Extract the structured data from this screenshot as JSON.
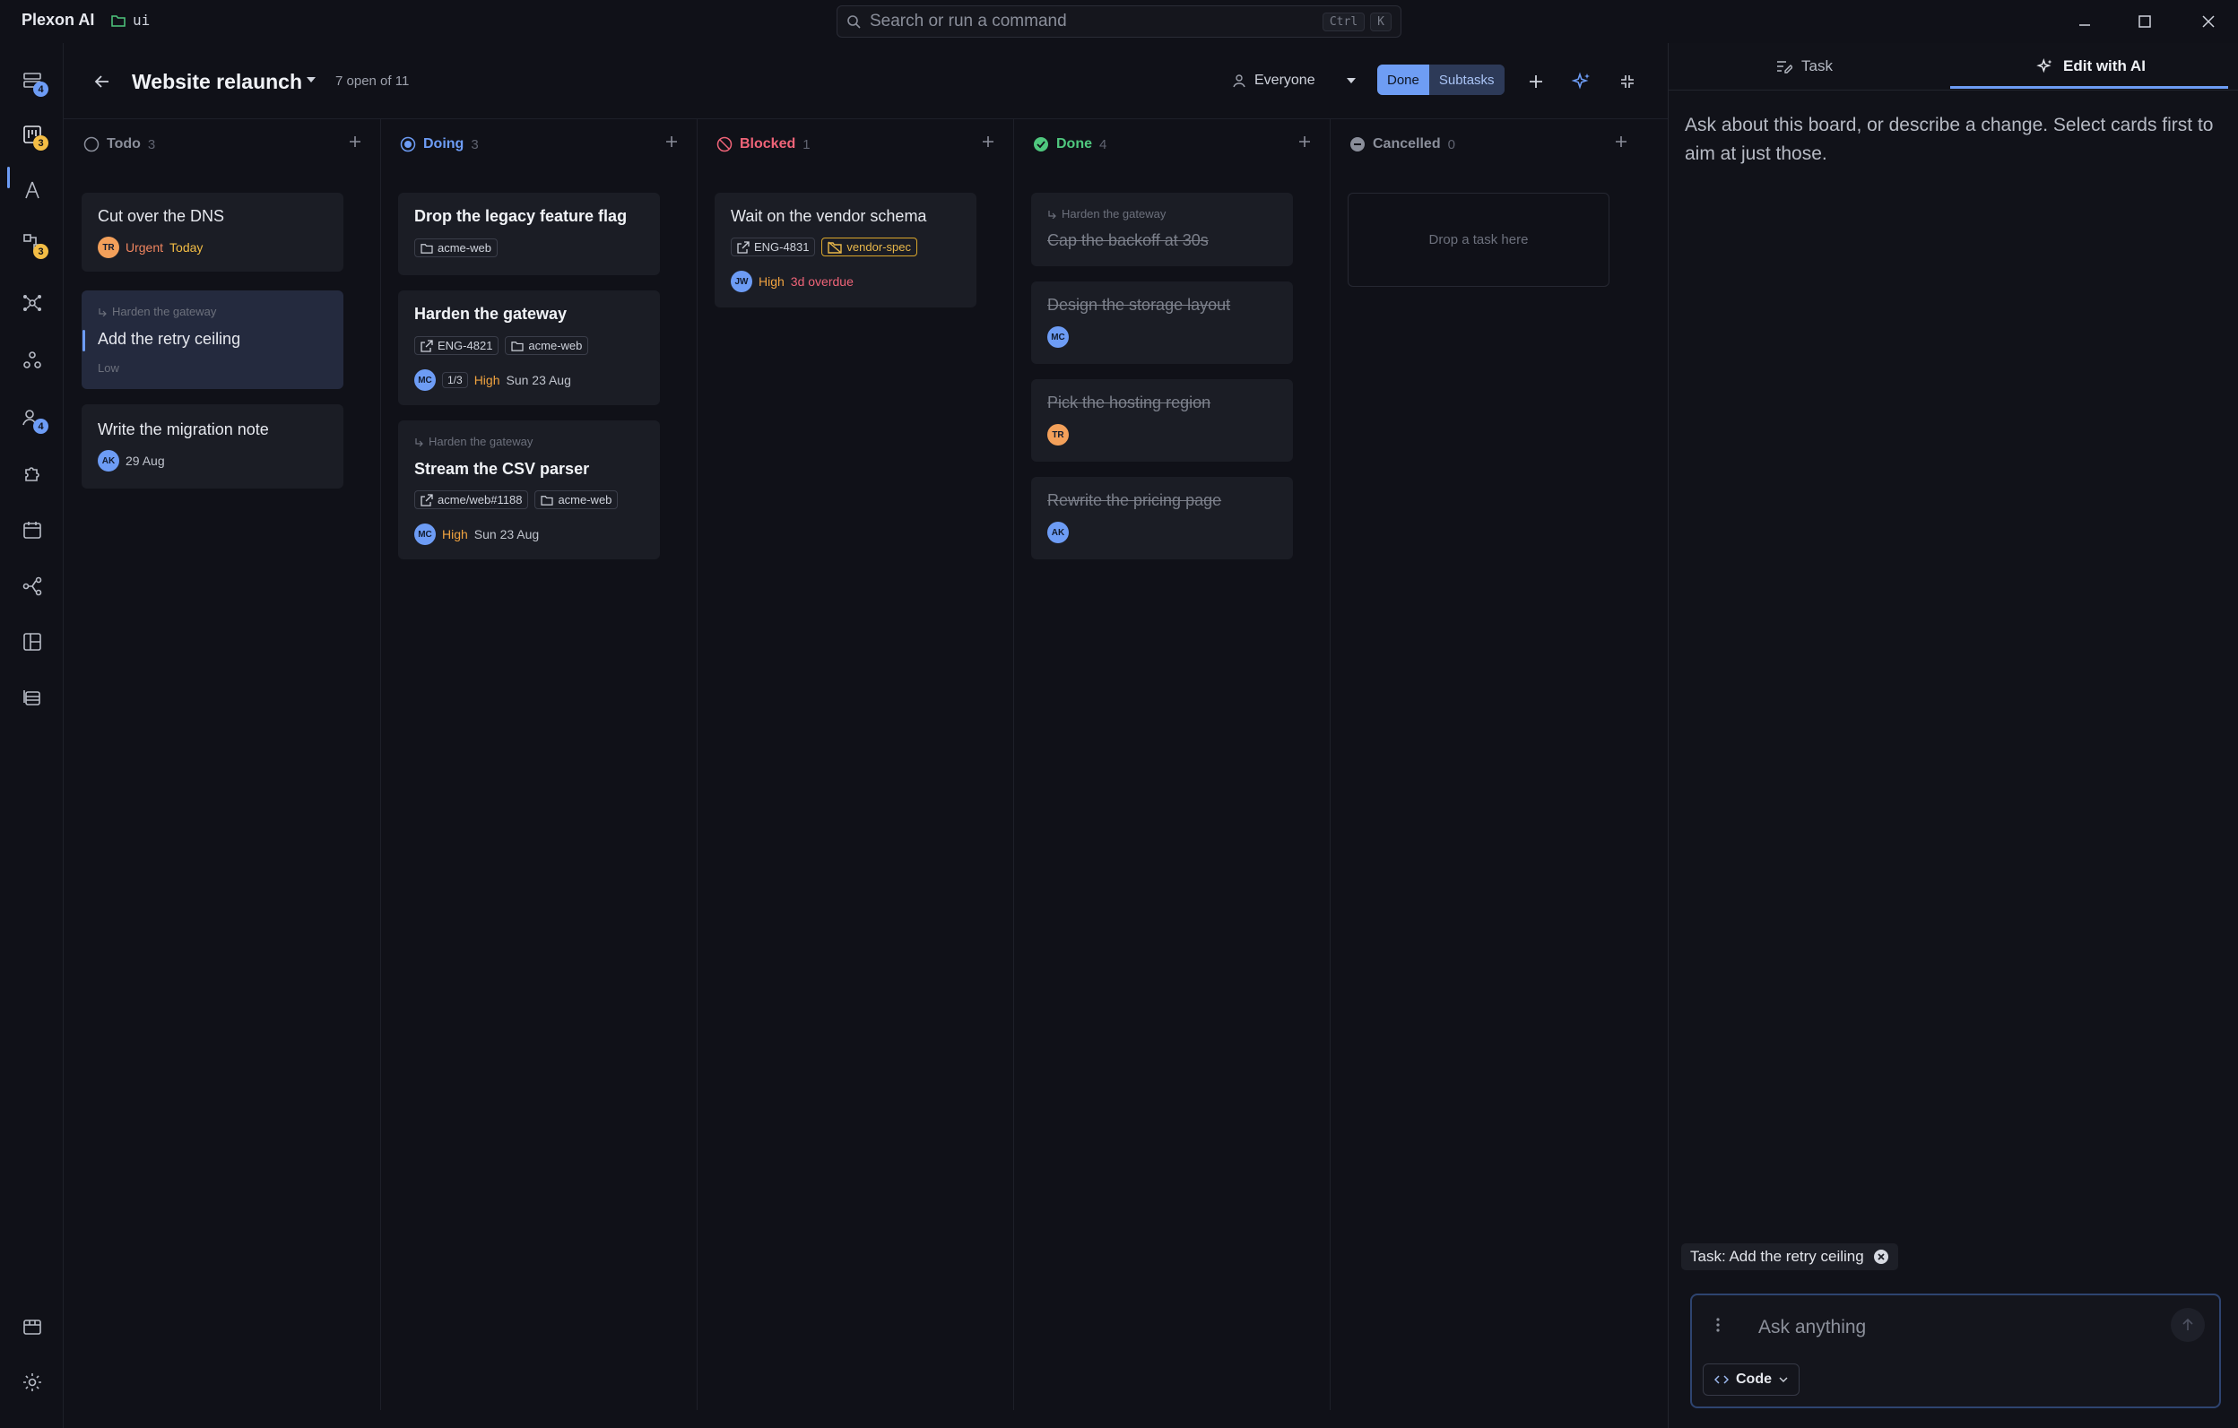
{
  "app": {
    "name": "Plexon AI",
    "folder": "ui"
  },
  "search": {
    "placeholder": "Search or run a command",
    "kbd1": "Ctrl",
    "kbd2": "K"
  },
  "rail": {
    "badges": [
      "4",
      "3",
      "3",
      "4"
    ]
  },
  "board": {
    "title": "Website relaunch",
    "count": "7 open of 11",
    "assignee_filter": "Everyone",
    "toggle_done": "Done",
    "toggle_subtasks": "Subtasks"
  },
  "columns": [
    {
      "name": "Todo",
      "count": "3",
      "color": "#8a8e9a"
    },
    {
      "name": "Doing",
      "count": "3",
      "color": "#6d9cf5"
    },
    {
      "name": "Blocked",
      "count": "1",
      "color": "#ef6478"
    },
    {
      "name": "Done",
      "count": "4",
      "color": "#4fc77e"
    },
    {
      "name": "Cancelled",
      "count": "0",
      "color": "#8a8e9a"
    }
  ],
  "cards": {
    "todo": [
      {
        "title": "Cut over the DNS",
        "avatar": "TR",
        "priority": "Urgent",
        "due": "Today"
      },
      {
        "parent": "Harden the gateway",
        "title": "Add the retry ceiling",
        "priority": "Low"
      },
      {
        "title": "Write the migration note",
        "avatar": "AK",
        "due": "29 Aug"
      }
    ],
    "doing": [
      {
        "title": "Drop the legacy feature flag",
        "folder": "acme-web"
      },
      {
        "title": "Harden the gateway",
        "ref": "ENG-4821",
        "folder": "acme-web",
        "avatar": "MC",
        "progress": "1/3",
        "priority": "High",
        "due": "Sun 23 Aug"
      },
      {
        "parent": "Harden the gateway",
        "title": "Stream the CSV parser",
        "ref": "acme/web#1188",
        "folder": "acme-web",
        "avatar": "MC",
        "priority": "High",
        "due": "Sun 23 Aug"
      }
    ],
    "blocked": [
      {
        "title": "Wait on the vendor schema",
        "ref": "ENG-4831",
        "tag": "vendor-spec",
        "avatar": "JW",
        "priority": "High",
        "due": "3d overdue"
      }
    ],
    "done": [
      {
        "parent": "Harden the gateway",
        "title": "Cap the backoff at 30s"
      },
      {
        "title": "Design the storage layout",
        "avatar": "MC"
      },
      {
        "title": "Pick the hosting region",
        "avatar": "TR"
      },
      {
        "title": "Rewrite the pricing page",
        "avatar": "AK"
      }
    ],
    "cancelled_drop": "Drop a task here"
  },
  "panel": {
    "tab_task": "Task",
    "tab_ai": "Edit with AI",
    "intro": "Ask about this board, or describe a change. Select cards first to aim at just those.",
    "context_chip": "Task: Add the retry ceiling",
    "placeholder": "Ask anything",
    "mode": "Code"
  },
  "colors": {
    "accent": "#6d9cf5",
    "background": "#101118",
    "card": "#1b1d25"
  }
}
